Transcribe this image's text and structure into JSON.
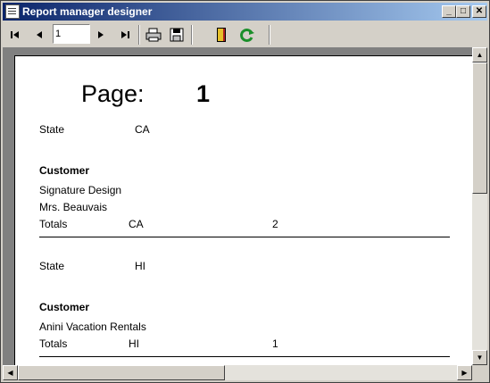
{
  "window": {
    "title": "Report manager designer"
  },
  "toolbar": {
    "page_value": "1",
    "icons": [
      "first-page-icon",
      "prev-page-icon",
      "next-page-icon",
      "last-page-icon",
      "print-icon",
      "save-icon",
      "exit-icon",
      "refresh-icon"
    ]
  },
  "report": {
    "page_label": "Page:",
    "page_number": "1",
    "groups": [
      {
        "state_label": "State",
        "state_value": "CA",
        "customer_header": "Customer",
        "customers": [
          "Signature Design",
          "Mrs. Beauvais"
        ],
        "totals_label": "Totals",
        "totals_state": "CA",
        "totals_count": "2"
      },
      {
        "state_label": "State",
        "state_value": "HI",
        "customer_header": "Customer",
        "customers": [
          "Anini Vacation Rentals"
        ],
        "totals_label": "Totals",
        "totals_state": "HI",
        "totals_count": "1"
      }
    ]
  },
  "colors": {
    "titlebar_start": "#0a246a",
    "titlebar_end": "#a6caf0",
    "chrome": "#d4d0c8",
    "viewport": "#808080"
  }
}
